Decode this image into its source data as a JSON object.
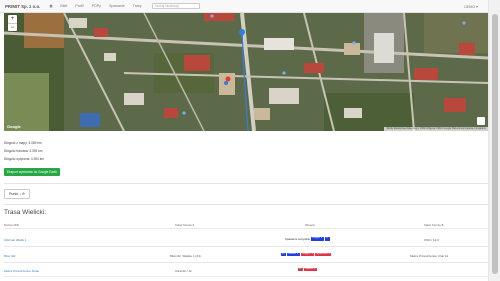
{
  "navbar": {
    "brand": "PRIMIT Sp. z o.o.",
    "links": [
      "Bilet",
      "Profil",
      "POPy",
      "Spawanie",
      "Trasy"
    ],
    "search_placeholder": "Szukaj lokalizacji",
    "user": "DEMO ▾"
  },
  "map": {
    "zoom_in": "+",
    "zoom_out": "−",
    "logo": "Google",
    "attribution": "Skróty klawiszowe  Dane mapy ©2021  Zdjęcia ©2021 Google  Warunki korzystania z programu",
    "colors": {
      "vegetation": "#4f6238",
      "roofs_red": "#b8483b",
      "roads": "#c9c3b4",
      "marker_blue": "#2f7ee0",
      "marker_red": "#e23a2f"
    }
  },
  "distances": [
    "Długość z mapy: 3.069 km",
    "Długość trasowa: 4.394 km",
    "Długość optyczna: 4.394 km"
  ],
  "buttons": {
    "export": "Eksport wymiarów do Google Earth",
    "add_point": "Punkt ↓ ⟳"
  },
  "route": {
    "title": "Trasa Wielicki:",
    "columns": [
      "Nazwa ODF",
      "Kabel Stronie A",
      "Wpięcie",
      "Kabel Stronie B"
    ],
    "rows": [
      {
        "name": "Odcinek Wielki 1",
        "cable_a": "",
        "link_text": "Spawanie wszystkie",
        "tags": [
          {
            "label": "Przyjęte ▼",
            "color": "blue"
          },
          {
            "label": "ZP",
            "color": "blue"
          }
        ],
        "cable_b": "OSN / 12.0"
      },
      {
        "name": "Brze GD",
        "cable_a": "Bloki 02, Wielkie 1 (24)",
        "link_text": "",
        "tags": [
          {
            "label": "ZP",
            "color": "blue"
          },
          {
            "label": "Odcinek ▼",
            "color": "blue"
          },
          {
            "label": "Przyjęcie ▼",
            "color": "red"
          },
          {
            "label": "Wyłączenie ▼",
            "color": "red"
          }
        ],
        "cable_b": "Mokre Przestrzenne, blok 12"
      },
      {
        "name": "Mokre Przestrzenne Ściek",
        "cable_a": "Ulica 02 / 12",
        "link_text": "",
        "tags": [
          {
            "label": "ZP",
            "color": "red"
          },
          {
            "label": "Wydanie ▼",
            "color": "red"
          }
        ],
        "cable_b": ""
      }
    ]
  }
}
